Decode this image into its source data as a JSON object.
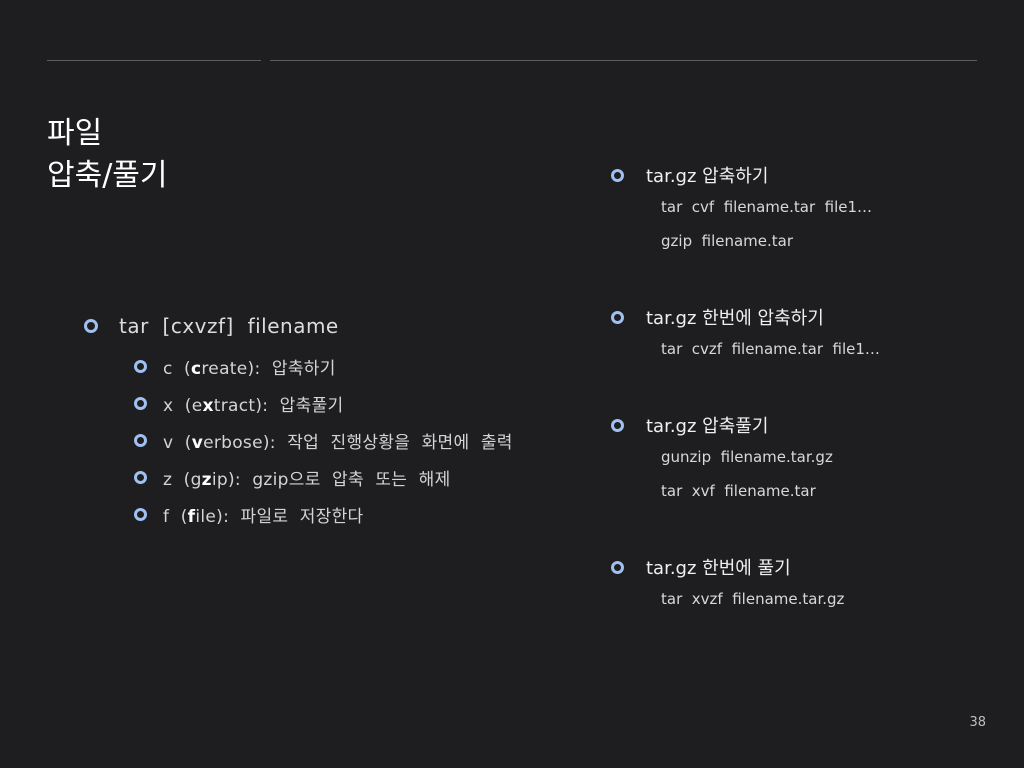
{
  "title": {
    "line1": "파일",
    "line2": "압축/풀기"
  },
  "left": {
    "main": "tar  [cxvzf]  filename",
    "options": [
      {
        "pre": "c  (",
        "key": "c",
        "post": "reate):  압축하기"
      },
      {
        "pre": "x  (e",
        "key": "x",
        "post": "tract):  압축풀기"
      },
      {
        "pre": "v  (",
        "key": "v",
        "post": "erbose):  작업  진행상황을  화면에  출력"
      },
      {
        "pre": "z  (g",
        "key": "z",
        "post": "ip):  gzip으로  압축  또는  해제"
      },
      {
        "pre": "f  (",
        "key": "f",
        "post": "ile):  파일로  저장한다"
      }
    ]
  },
  "right": [
    {
      "heading": "tar.gz 압축하기",
      "lines": [
        "tar  cvf  filename.tar  file1…",
        "gzip  filename.tar"
      ]
    },
    {
      "heading": "tar.gz 한번에 압축하기",
      "lines": [
        "tar  cvzf  filename.tar  file1…"
      ]
    },
    {
      "heading": "tar.gz 압축풀기",
      "lines": [
        "gunzip  filename.tar.gz",
        "tar  xvf  filename.tar"
      ]
    },
    {
      "heading": "tar.gz 한번에 풀기",
      "lines": [
        "tar  xvzf  filename.tar.gz"
      ]
    }
  ],
  "page_number": "38",
  "colors": {
    "background": "#1e1e20",
    "bullet": "#9fc0f0",
    "text": "#ececec"
  }
}
